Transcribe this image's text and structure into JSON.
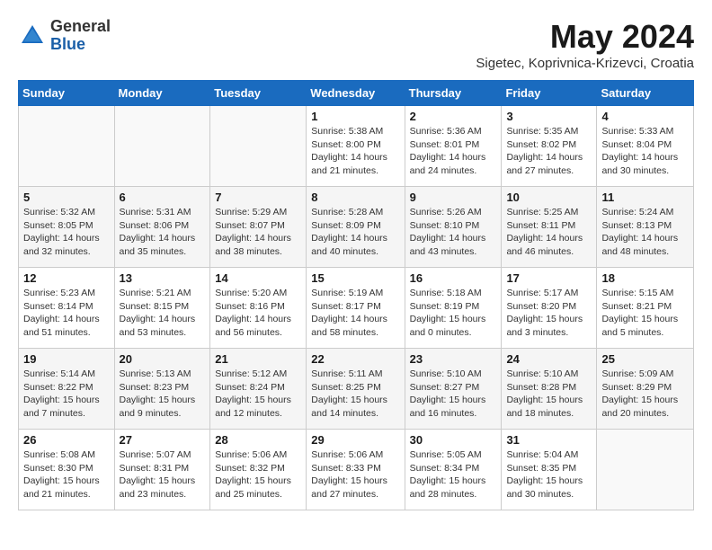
{
  "header": {
    "logo_general": "General",
    "logo_blue": "Blue",
    "month_title": "May 2024",
    "location": "Sigetec, Koprivnica-Krizevci, Croatia"
  },
  "calendar": {
    "weekdays": [
      "Sunday",
      "Monday",
      "Tuesday",
      "Wednesday",
      "Thursday",
      "Friday",
      "Saturday"
    ],
    "weeks": [
      [
        {
          "day": "",
          "info": ""
        },
        {
          "day": "",
          "info": ""
        },
        {
          "day": "",
          "info": ""
        },
        {
          "day": "1",
          "info": "Sunrise: 5:38 AM\nSunset: 8:00 PM\nDaylight: 14 hours\nand 21 minutes."
        },
        {
          "day": "2",
          "info": "Sunrise: 5:36 AM\nSunset: 8:01 PM\nDaylight: 14 hours\nand 24 minutes."
        },
        {
          "day": "3",
          "info": "Sunrise: 5:35 AM\nSunset: 8:02 PM\nDaylight: 14 hours\nand 27 minutes."
        },
        {
          "day": "4",
          "info": "Sunrise: 5:33 AM\nSunset: 8:04 PM\nDaylight: 14 hours\nand 30 minutes."
        }
      ],
      [
        {
          "day": "5",
          "info": "Sunrise: 5:32 AM\nSunset: 8:05 PM\nDaylight: 14 hours\nand 32 minutes."
        },
        {
          "day": "6",
          "info": "Sunrise: 5:31 AM\nSunset: 8:06 PM\nDaylight: 14 hours\nand 35 minutes."
        },
        {
          "day": "7",
          "info": "Sunrise: 5:29 AM\nSunset: 8:07 PM\nDaylight: 14 hours\nand 38 minutes."
        },
        {
          "day": "8",
          "info": "Sunrise: 5:28 AM\nSunset: 8:09 PM\nDaylight: 14 hours\nand 40 minutes."
        },
        {
          "day": "9",
          "info": "Sunrise: 5:26 AM\nSunset: 8:10 PM\nDaylight: 14 hours\nand 43 minutes."
        },
        {
          "day": "10",
          "info": "Sunrise: 5:25 AM\nSunset: 8:11 PM\nDaylight: 14 hours\nand 46 minutes."
        },
        {
          "day": "11",
          "info": "Sunrise: 5:24 AM\nSunset: 8:13 PM\nDaylight: 14 hours\nand 48 minutes."
        }
      ],
      [
        {
          "day": "12",
          "info": "Sunrise: 5:23 AM\nSunset: 8:14 PM\nDaylight: 14 hours\nand 51 minutes."
        },
        {
          "day": "13",
          "info": "Sunrise: 5:21 AM\nSunset: 8:15 PM\nDaylight: 14 hours\nand 53 minutes."
        },
        {
          "day": "14",
          "info": "Sunrise: 5:20 AM\nSunset: 8:16 PM\nDaylight: 14 hours\nand 56 minutes."
        },
        {
          "day": "15",
          "info": "Sunrise: 5:19 AM\nSunset: 8:17 PM\nDaylight: 14 hours\nand 58 minutes."
        },
        {
          "day": "16",
          "info": "Sunrise: 5:18 AM\nSunset: 8:19 PM\nDaylight: 15 hours\nand 0 minutes."
        },
        {
          "day": "17",
          "info": "Sunrise: 5:17 AM\nSunset: 8:20 PM\nDaylight: 15 hours\nand 3 minutes."
        },
        {
          "day": "18",
          "info": "Sunrise: 5:15 AM\nSunset: 8:21 PM\nDaylight: 15 hours\nand 5 minutes."
        }
      ],
      [
        {
          "day": "19",
          "info": "Sunrise: 5:14 AM\nSunset: 8:22 PM\nDaylight: 15 hours\nand 7 minutes."
        },
        {
          "day": "20",
          "info": "Sunrise: 5:13 AM\nSunset: 8:23 PM\nDaylight: 15 hours\nand 9 minutes."
        },
        {
          "day": "21",
          "info": "Sunrise: 5:12 AM\nSunset: 8:24 PM\nDaylight: 15 hours\nand 12 minutes."
        },
        {
          "day": "22",
          "info": "Sunrise: 5:11 AM\nSunset: 8:25 PM\nDaylight: 15 hours\nand 14 minutes."
        },
        {
          "day": "23",
          "info": "Sunrise: 5:10 AM\nSunset: 8:27 PM\nDaylight: 15 hours\nand 16 minutes."
        },
        {
          "day": "24",
          "info": "Sunrise: 5:10 AM\nSunset: 8:28 PM\nDaylight: 15 hours\nand 18 minutes."
        },
        {
          "day": "25",
          "info": "Sunrise: 5:09 AM\nSunset: 8:29 PM\nDaylight: 15 hours\nand 20 minutes."
        }
      ],
      [
        {
          "day": "26",
          "info": "Sunrise: 5:08 AM\nSunset: 8:30 PM\nDaylight: 15 hours\nand 21 minutes."
        },
        {
          "day": "27",
          "info": "Sunrise: 5:07 AM\nSunset: 8:31 PM\nDaylight: 15 hours\nand 23 minutes."
        },
        {
          "day": "28",
          "info": "Sunrise: 5:06 AM\nSunset: 8:32 PM\nDaylight: 15 hours\nand 25 minutes."
        },
        {
          "day": "29",
          "info": "Sunrise: 5:06 AM\nSunset: 8:33 PM\nDaylight: 15 hours\nand 27 minutes."
        },
        {
          "day": "30",
          "info": "Sunrise: 5:05 AM\nSunset: 8:34 PM\nDaylight: 15 hours\nand 28 minutes."
        },
        {
          "day": "31",
          "info": "Sunrise: 5:04 AM\nSunset: 8:35 PM\nDaylight: 15 hours\nand 30 minutes."
        },
        {
          "day": "",
          "info": ""
        }
      ]
    ]
  }
}
